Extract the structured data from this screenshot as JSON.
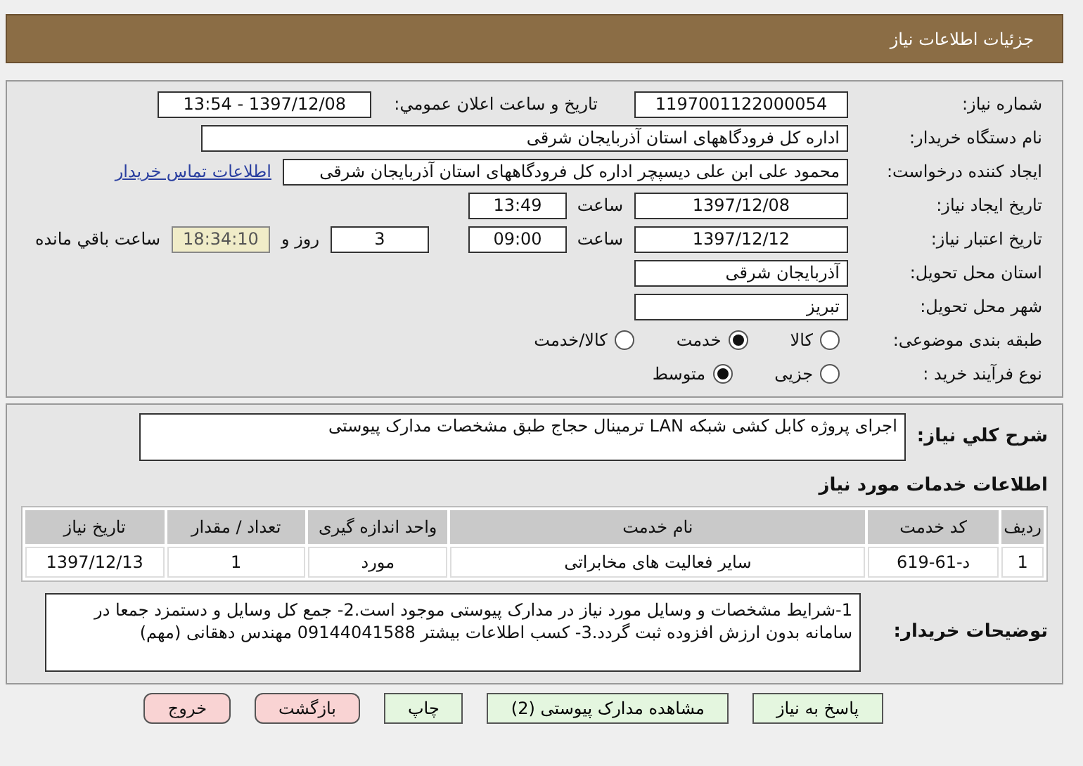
{
  "header": {
    "title": "جزئیات اطلاعات نیاز"
  },
  "need_number": {
    "label": "شماره نیاز:",
    "value": "1197001122000054"
  },
  "announce": {
    "label": "تاریخ و ساعت اعلان عمومي:",
    "value": "1397/12/08 - 13:54"
  },
  "buyer": {
    "label": "نام دستگاه خریدار:",
    "value": "اداره کل فرودگاههای استان آذربایجان شرقی"
  },
  "requester": {
    "label": "ایجاد کننده درخواست:",
    "value": "محمود علی ابن علی دیسپچر اداره کل فرودگاههای استان آذربایجان شرقی",
    "link": "اطلاعات تماس خریدار"
  },
  "created": {
    "label": "تاریخ ایجاد نیاز:",
    "date": "1397/12/08",
    "time_label": "ساعت",
    "time": "13:49"
  },
  "validity": {
    "label": "تاریخ اعتبار نیاز:",
    "date": "1397/12/12",
    "time_label": "ساعت",
    "time": "09:00",
    "days": "3",
    "days_label": "روز و",
    "remaining": "18:34:10",
    "remaining_label": "ساعت باقي مانده"
  },
  "province": {
    "label": "استان محل تحویل:",
    "value": "آذربایجان شرقی"
  },
  "city": {
    "label": "شهر محل تحویل:",
    "value": "تبریز"
  },
  "category": {
    "label": "طبقه بندی موضوعی:",
    "options": [
      {
        "label": "کالا",
        "selected": false
      },
      {
        "label": "خدمت",
        "selected": true
      },
      {
        "label": "کالا/خدمت",
        "selected": false
      }
    ]
  },
  "process": {
    "label": "نوع فرآیند خرید :",
    "options": [
      {
        "label": "جزیی",
        "selected": false
      },
      {
        "label": "متوسط",
        "selected": true
      }
    ]
  },
  "description": {
    "label": "شرح كلي نياز:",
    "value": "اجرای پروژه کابل کشی شبکه LAN ترمینال حجاج طبق مشخصات مدارک پیوستی"
  },
  "services": {
    "title": "اطلاعات خدمات مورد نیاز",
    "columns": [
      "ردیف",
      "کد خدمت",
      "نام خدمت",
      "واحد اندازه گیری",
      "تعداد / مقدار",
      "تاریخ نیاز"
    ],
    "rows": [
      [
        "1",
        "د-61-619",
        "سایر فعالیت های مخابراتی",
        "مورد",
        "1",
        "1397/12/13"
      ]
    ]
  },
  "buyer_notes": {
    "label": "توضیحات خریدار:",
    "value": "1-شرایط مشخصات و وسایل مورد نیاز در مدارک پیوستی موجود است.2- جمع کل وسایل و دستمزد جمعا در سامانه بدون ارزش افزوده ثبت گردد.3- کسب اطلاعات بیشتر 09144041588 مهندس دهقانی (مهم)"
  },
  "buttons": [
    {
      "label": "پاسخ به نیاز",
      "kind": "normal"
    },
    {
      "label": "مشاهده مدارک پیوستی (2)",
      "kind": "normal"
    },
    {
      "label": "چاپ",
      "kind": "normal"
    },
    {
      "label": "بازگشت",
      "kind": "alert"
    },
    {
      "label": "خروج",
      "kind": "alert"
    }
  ]
}
